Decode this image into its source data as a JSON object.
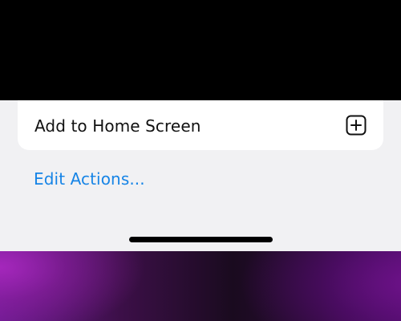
{
  "share_sheet": {
    "actions": [
      {
        "label": "Add to Home Screen",
        "icon": "plus-square-icon"
      }
    ],
    "edit_actions_label": "Edit Actions..."
  },
  "colors": {
    "sheet_background": "#f1f1f3",
    "row_background": "#ffffff",
    "link_blue": "#1684e6",
    "text": "#111111",
    "home_indicator": "#000000"
  }
}
